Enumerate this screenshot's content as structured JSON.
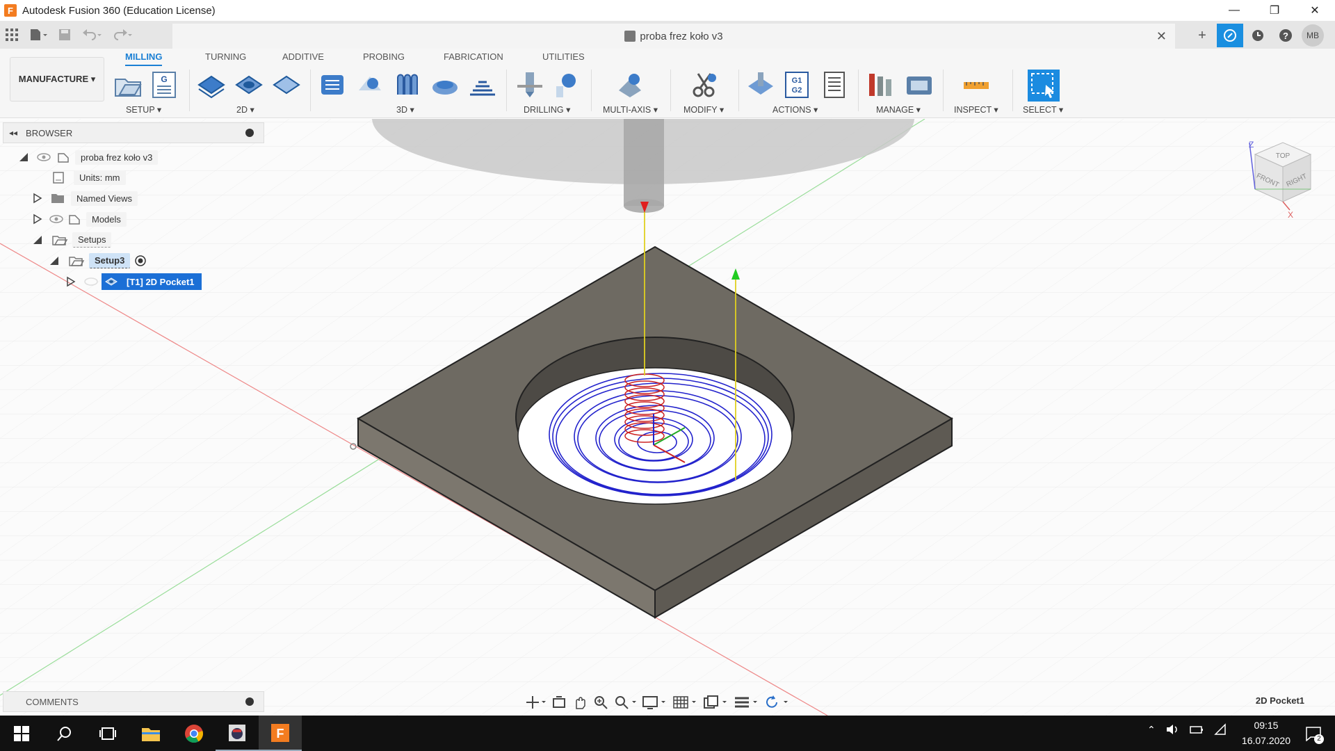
{
  "window": {
    "title": "Autodesk Fusion 360 (Education License)",
    "app_icon": "F",
    "minimize": "—",
    "restore": "❐",
    "close": "✕"
  },
  "document": {
    "tab_title": "proba frez koło v3",
    "close": "✕"
  },
  "toolbar_right": {
    "add": "+",
    "user_initials": "MB"
  },
  "ribbon": {
    "workspace": "MANUFACTURE ▾",
    "tabs": [
      "MILLING",
      "TURNING",
      "ADDITIVE",
      "PROBING",
      "FABRICATION",
      "UTILITIES"
    ],
    "groups": [
      "SETUP ▾",
      "2D ▾",
      "3D ▾",
      "DRILLING ▾",
      "MULTI-AXIS ▾",
      "MODIFY ▾",
      "ACTIONS ▾",
      "MANAGE ▾",
      "INSPECT ▾",
      "SELECT ▾"
    ],
    "actions_g1g2": "G1\nG2"
  },
  "browser": {
    "header": "BROWSER",
    "items": [
      {
        "label": "proba frez koło v3"
      },
      {
        "label": "Units: mm"
      },
      {
        "label": "Named Views"
      },
      {
        "label": "Models"
      },
      {
        "label": "Setups"
      },
      {
        "label": "Setup3"
      },
      {
        "label": "[T1] 2D Pocket1"
      }
    ]
  },
  "viewcube": {
    "top": "TOP",
    "front": "FRONT",
    "right": "RIGHT",
    "z": "Z",
    "x": "X"
  },
  "comments": {
    "label": "COMMENTS"
  },
  "status": {
    "selection": "2D Pocket1"
  },
  "taskbar": {
    "time": "09:15",
    "date": "16.07.2020",
    "notifications": "2"
  },
  "colors": {
    "accent": "#1a7fd4",
    "toolpath": "#2222cc",
    "plunge": "#cc2222",
    "stock": "#6e6a62",
    "highlight": "#1b6fd6"
  }
}
